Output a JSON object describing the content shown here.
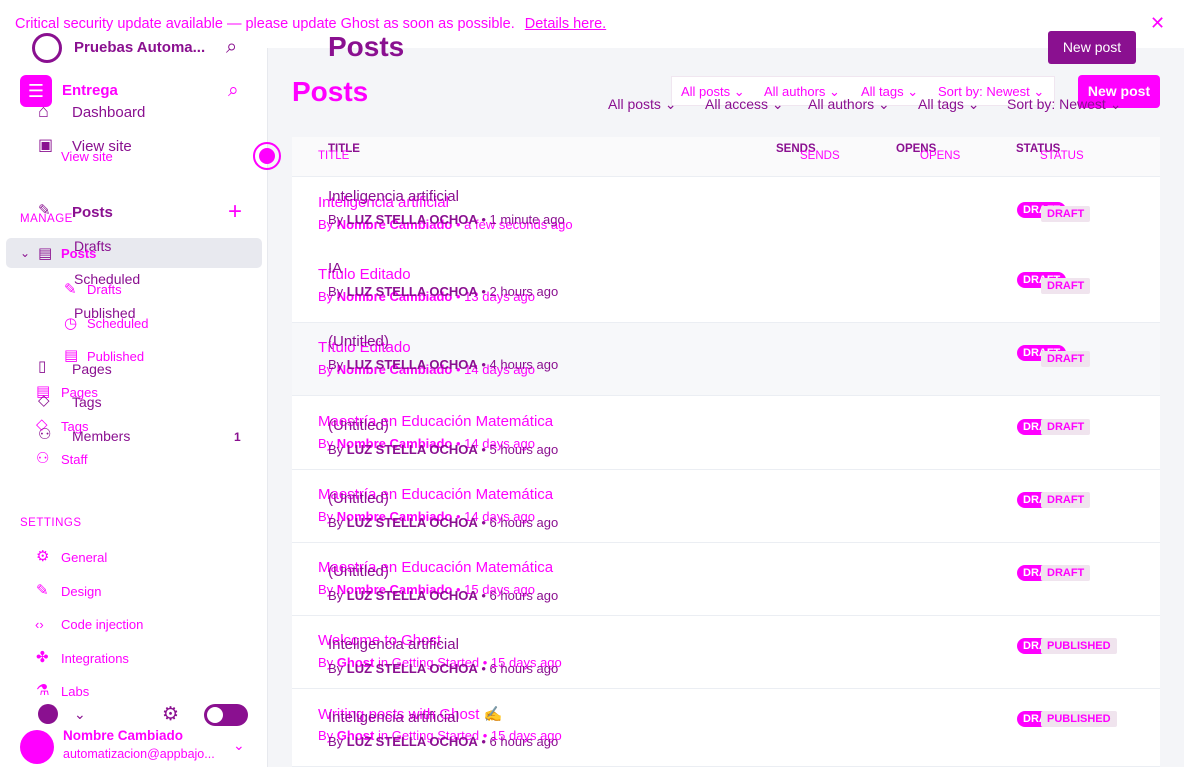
{
  "banner": {
    "text": "Critical security update available — please update Ghost as soon as possible.",
    "link": "Details here.",
    "close_icon": "close-icon"
  },
  "sidebar": {
    "site_name": "Pruebas Automa...",
    "workspace": "Entrega",
    "icons": [
      "ghost-logo-icon",
      "search-icon",
      "sliders-icon",
      "home-icon",
      "browser-icon",
      "edit-icon",
      "plus-icon",
      "list-icon",
      "pencil-icon",
      "clock-icon",
      "doc-icon",
      "tag-icon",
      "people-icon",
      "staff-icon",
      "gear-icon",
      "brush-icon",
      "code-icon",
      "puzzle-icon",
      "flask-icon",
      "avatar-icon",
      "chevron-down-icon",
      "moon-icon"
    ],
    "nav_top": [
      {
        "label": "Dashboard"
      },
      {
        "label": "View site"
      },
      {
        "label": "View site"
      }
    ],
    "manage_label": "MANAGE",
    "posts_primary": "Posts",
    "posts_secondary": "Posts",
    "sub_items": [
      "Drafts",
      "Scheduled",
      "Published"
    ],
    "sub_items_secondary": [
      "Drafts",
      "Scheduled",
      "Published"
    ],
    "pages": [
      "Pages",
      "Pages"
    ],
    "tags": [
      "Tags",
      "Tags"
    ],
    "members": {
      "label": "Members",
      "count": "1"
    },
    "staff": "Staff",
    "settings_label": "SETTINGS",
    "settings_items": [
      "General",
      "Design",
      "Code injection",
      "Integrations",
      "Labs"
    ],
    "user": {
      "name": "Nombre Cambiado",
      "email": "automatizacion@appbajo..."
    }
  },
  "main": {
    "title_primary": "Posts",
    "title_secondary": "Posts",
    "new_post_1": "New post",
    "new_post_2": "New post",
    "filters_top": [
      "All posts",
      "All authors",
      "All tags",
      "Sort by: Newest"
    ],
    "filters_bottom": [
      "All posts",
      "All access",
      "All authors",
      "All tags",
      "Sort by: Newest"
    ],
    "columns": {
      "title": "TITLE",
      "sends": "SENDS",
      "opens": "OPENS",
      "status": "STATUS"
    },
    "rows_front": [
      {
        "title": "Inteligencia artificial",
        "by": "By",
        "author": "LUZ STELLA OCHOA",
        "time": "• 1 minute ago",
        "status": "DRAFT"
      },
      {
        "title": "IA",
        "by": "By",
        "author": "LUZ STELLA OCHOA",
        "time": "• 2 hours ago",
        "status": "DRAFT"
      },
      {
        "title": "(Untitled)",
        "by": "By",
        "author": "LUZ STELLA OCHOA",
        "time": "• 4 hours ago",
        "status": "DRAFT"
      },
      {
        "title": "(Untitled)",
        "by": "By",
        "author": "LUZ STELLA OCHOA",
        "time": "• 5 hours ago",
        "status": "DRAFT"
      },
      {
        "title": "(Untitled)",
        "by": "By",
        "author": "LUZ STELLA OCHOA",
        "time": "• 6 hours ago",
        "status": "DRAFT"
      },
      {
        "title": "(Untitled)",
        "by": "By",
        "author": "LUZ STELLA OCHOA",
        "time": "• 6 hours ago",
        "status": "DRAFT"
      },
      {
        "title": "Inteligencia artificial",
        "by": "By",
        "author": "LUZ STELLA OCHOA",
        "time": "• 6 hours ago",
        "status": "PUBLISHED"
      },
      {
        "title": "Inteligencia artificial",
        "by": "By",
        "author": "LUZ STELLA OCHOA",
        "time": "• 6 hours ago",
        "status": "PUBLISHED"
      }
    ],
    "rows_back": [
      {
        "title": "Inteligencia artificial",
        "by": "By",
        "author": "Nombre Cambiado",
        "time": "• a few seconds ago",
        "status": "DRAFT"
      },
      {
        "title": "Título Editado",
        "by": "By",
        "author": "Nombre Cambiado",
        "time": "• 13 days ago",
        "status": "DRAFT"
      },
      {
        "title": "Título Editado",
        "by": "By",
        "author": "Nombre Cambiado",
        "time": "• 14 days ago",
        "status": "DRAFT"
      },
      {
        "title": "Maestría en Educación Matemática",
        "by": "By",
        "author": "Nombre Cambiado",
        "time": "• 14 days ago",
        "status": "DRAFT"
      },
      {
        "title": "Maestría en Educación Matemática",
        "by": "By",
        "author": "Nombre Cambiado",
        "time": "• 14 days ago",
        "status": "DRAFT"
      },
      {
        "title": "Maestría en Educación Matemática",
        "by": "By",
        "author": "Nombre Cambiado",
        "time": "• 15 days ago",
        "status": "DRAFT"
      },
      {
        "title": "Welcome to Ghost",
        "by": "By",
        "author": "Ghost",
        "time": "in Getting Started • 15 days ago",
        "status": "DRAFT"
      },
      {
        "title": "Writing posts with Ghost ✍️",
        "by": "By",
        "author": "Ghost",
        "time": "in Getting Started • 15 days ago",
        "status": "DRAFT"
      }
    ]
  }
}
